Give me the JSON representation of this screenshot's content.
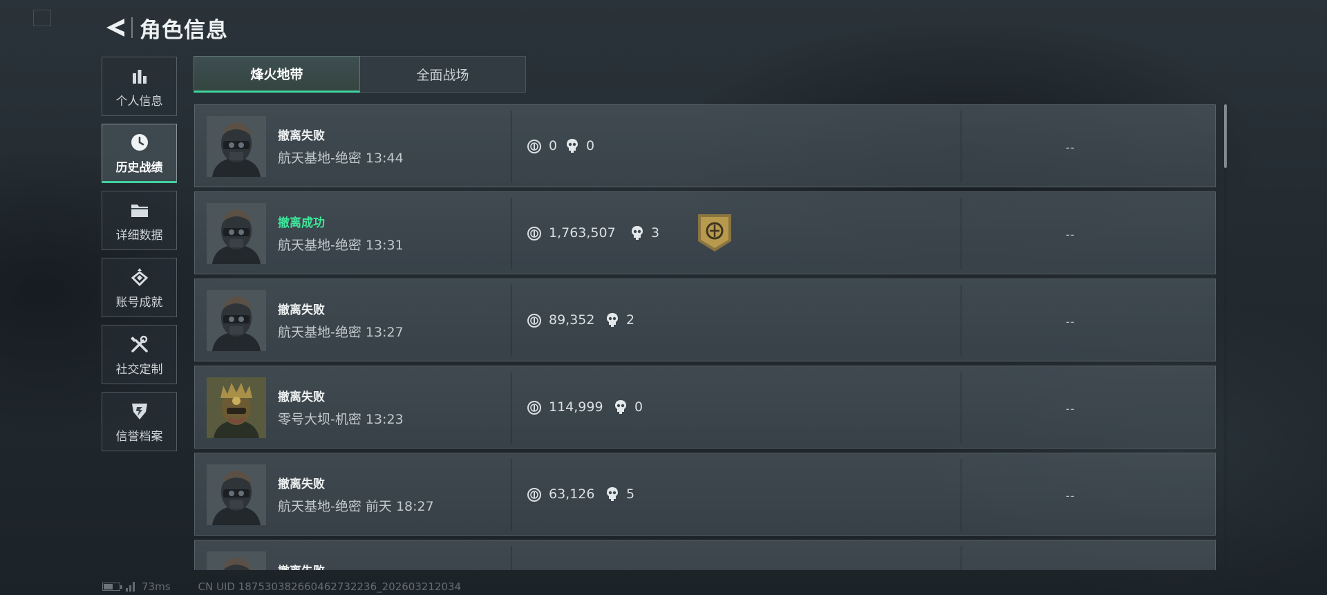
{
  "header": {
    "title": "角色信息"
  },
  "sidebar": {
    "items": [
      {
        "label": "个人信息",
        "icon": "bar-chart-icon",
        "active": false
      },
      {
        "label": "历史战绩",
        "icon": "clock-icon",
        "active": true
      },
      {
        "label": "详细数据",
        "icon": "folder-icon",
        "active": false
      },
      {
        "label": "账号成就",
        "icon": "achievement-icon",
        "active": false
      },
      {
        "label": "社交定制",
        "icon": "tools-icon",
        "active": false
      },
      {
        "label": "信誉档案",
        "icon": "shield-icon",
        "active": false
      }
    ]
  },
  "tabs": [
    {
      "label": "烽火地带",
      "active": true
    },
    {
      "label": "全面战场",
      "active": false
    }
  ],
  "matches": [
    {
      "result": "撤离失败",
      "success": false,
      "map": "航天基地-绝密",
      "time": "13:44",
      "money": "0",
      "kills": "0",
      "badge": false,
      "extra": "--",
      "avatar": "operator-dark"
    },
    {
      "result": "撤离成功",
      "success": true,
      "map": "航天基地-绝密",
      "time": "13:31",
      "money": "1,763,507",
      "kills": "3",
      "badge": true,
      "extra": "--",
      "avatar": "operator-dark"
    },
    {
      "result": "撤离失败",
      "success": false,
      "map": "航天基地-绝密",
      "time": "13:27",
      "money": "89,352",
      "kills": "2",
      "badge": false,
      "extra": "--",
      "avatar": "operator-dark"
    },
    {
      "result": "撤离失败",
      "success": false,
      "map": "零号大坝-机密",
      "time": "13:23",
      "money": "114,999",
      "kills": "0",
      "badge": false,
      "extra": "--",
      "avatar": "operator-gold"
    },
    {
      "result": "撤离失败",
      "success": false,
      "map": "航天基地-绝密",
      "time": "前天 18:27",
      "money": "63,126",
      "kills": "5",
      "badge": false,
      "extra": "--",
      "avatar": "operator-dark"
    },
    {
      "result": "撤离失败",
      "success": false,
      "map": "",
      "time": "",
      "money": "",
      "kills": "",
      "badge": false,
      "extra": "",
      "avatar": "operator-dark"
    }
  ],
  "footer": {
    "latency": "73ms",
    "uid": "CN UID 187530382660462732236_202603212034",
    "battery_level": 0.6
  },
  "colors": {
    "accent": "#3fd3a0",
    "success": "#3ee59a",
    "badge_gold": "#b89a4e"
  }
}
